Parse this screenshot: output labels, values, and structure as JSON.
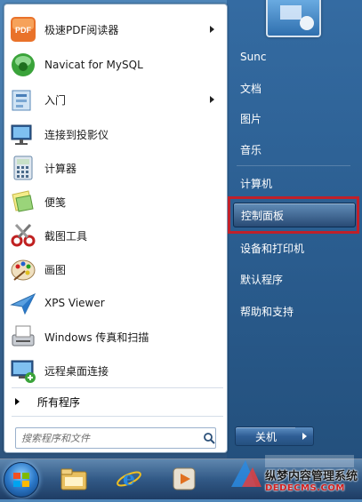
{
  "pinned": [
    {
      "label": "极速PDF阅读器",
      "icon": "pdf-reader-icon",
      "has_submenu": true
    },
    {
      "label": "Navicat for MySQL",
      "icon": "navicat-icon",
      "has_submenu": false
    },
    {
      "label": "入门",
      "icon": "getting-started-icon",
      "has_submenu": true
    },
    {
      "label": "连接到投影仪",
      "icon": "projector-icon",
      "has_submenu": false
    },
    {
      "label": "计算器",
      "icon": "calculator-icon",
      "has_submenu": false
    },
    {
      "label": "便笺",
      "icon": "sticky-notes-icon",
      "has_submenu": false
    },
    {
      "label": "截图工具",
      "icon": "snipping-tool-icon",
      "has_submenu": false
    },
    {
      "label": "画图",
      "icon": "paint-icon",
      "has_submenu": false
    },
    {
      "label": "XPS Viewer",
      "icon": "xps-viewer-icon",
      "has_submenu": false
    },
    {
      "label": "Windows 传真和扫描",
      "icon": "fax-scan-icon",
      "has_submenu": false
    },
    {
      "label": "远程桌面连接",
      "icon": "remote-desktop-icon",
      "has_submenu": false
    }
  ],
  "all_programs_label": "所有程序",
  "search": {
    "placeholder": "搜索程序和文件"
  },
  "right_links": [
    {
      "label": "Sunc"
    },
    {
      "label": "文档"
    },
    {
      "label": "图片"
    },
    {
      "label": "音乐"
    },
    {
      "label": "计算机"
    },
    {
      "label": "控制面板",
      "highlighted": true
    },
    {
      "label": "设备和打印机"
    },
    {
      "label": "默认程序"
    },
    {
      "label": "帮助和支持"
    }
  ],
  "shutdown_label": "关机",
  "taskbar_icons": [
    "start-orb",
    "file-explorer-icon",
    "internet-explorer-icon",
    "media-player-icon"
  ],
  "watermark": {
    "line1": "纵梦内容管理系统",
    "line2": "DEDECMS.COM"
  },
  "colors": {
    "highlight_box": "#c0202a",
    "panel_blue": "#3a6fa4"
  }
}
